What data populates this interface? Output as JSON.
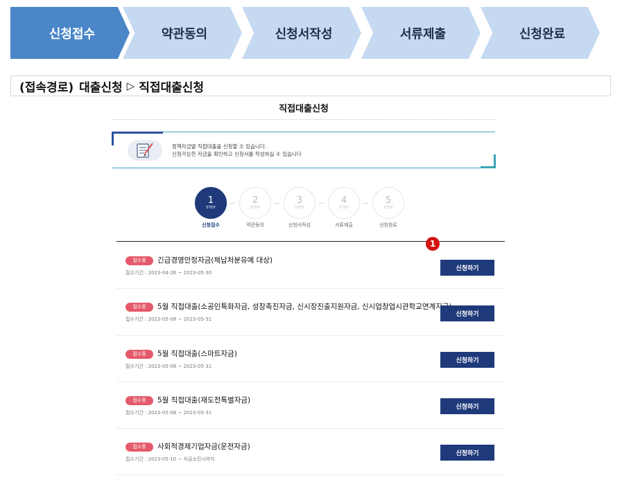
{
  "process_steps": [
    "신청접수",
    "약관동의",
    "신청서작성",
    "서류제출",
    "신청완료"
  ],
  "access_path": {
    "prefix": "(접속경로)",
    "from": "대출신청",
    "arrow": "▷",
    "to": "직접대출신청"
  },
  "page_title": "직접대출신청",
  "notice": {
    "line1": "정책자금별 직접대출을 신청할 수 있습니다.",
    "line2": "신청가능한 자금을 확인하고 신청서를 작성하실 수 있습니다"
  },
  "steps": [
    {
      "num": "1",
      "step": "STEP",
      "label": "신청접수"
    },
    {
      "num": "2",
      "step": "STEP",
      "label": "약관동의"
    },
    {
      "num": "3",
      "step": "STEP",
      "label": "신청서작성"
    },
    {
      "num": "4",
      "step": "STEP",
      "label": "서류제출"
    },
    {
      "num": "5",
      "step": "STEP",
      "label": "신청완료"
    }
  ],
  "marker": "1",
  "loans": [
    {
      "badge": "접수중",
      "title": "긴급경영안정자금(체납처분유예 대상)",
      "period": "접수기간 : 2023-04-26 ~ 2023-05-30",
      "button": "신청하기"
    },
    {
      "badge": "접수중",
      "title": "5월 직접대출(소공인특화자금, 성장촉진자금, 신시장진출지원자금, 신시업창업시관학교연계지금)",
      "period": "접수기간 : 2023-05-08 ~ 2023-05-31",
      "button": "신청하기"
    },
    {
      "badge": "접수중",
      "title": "5월 직접대출(스마트자금)",
      "period": "접수기간 : 2023-05-08 ~ 2023-05-31",
      "button": "신청하기"
    },
    {
      "badge": "접수중",
      "title": "5월 직접대출(재도전특별자금)",
      "period": "접수기간 : 2023-05-08 ~ 2023-05-31",
      "button": "신청하기"
    },
    {
      "badge": "접수중",
      "title": "사회적경제기업자금(운전자금)",
      "period": "접수기간 : 2023-05-10 ~ 자금소진시까지",
      "button": "신청하기"
    }
  ],
  "colors": {
    "active_step": "#4a86c8",
    "inactive_step": "#c5daf1",
    "primary": "#1f3a7a",
    "badge": "#e45a6a",
    "marker": "#d41414"
  }
}
